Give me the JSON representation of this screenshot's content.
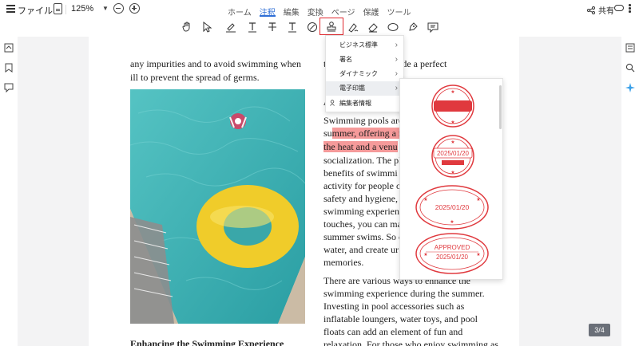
{
  "topbar": {
    "file_label": "ファイル",
    "zoom": "125%",
    "tabs": [
      {
        "label": "ホーム"
      },
      {
        "label": "注釈"
      },
      {
        "label": "編集"
      },
      {
        "label": "変換"
      },
      {
        "label": "ページ"
      },
      {
        "label": "保護"
      },
      {
        "label": "ツール"
      }
    ],
    "share_label": "共有"
  },
  "document": {
    "left_col_lines": [
      "any impurities and to avoid swimming when",
      "ill to prevent the spread of germs."
    ],
    "right_top_line": "t             g the poolside a perfect",
    "right_a_line": "A",
    "right_para1": [
      "Swimming pools are",
      "su",
      "mmer, offering a r",
      "the heat and a venu",
      "socialization. The pl",
      "benefits of swimmi",
      "activity for people o",
      "safety and hygiene,",
      "swimming experien",
      "touches, you can ma",
      "summer swims. So c",
      "water, and create ur",
      "memories."
    ],
    "right_para2": [
      "There are various ways to enhance the",
      "swimming experience during the summer.",
      "Investing in pool accessories such as",
      "inflatable loungers, water toys, and pool",
      "floats can add an element of fun and",
      "relaxation. For those who enjoy swimming as"
    ],
    "section_heading": "Enhancing the Swimming Experience"
  },
  "stamp_menu": {
    "items": [
      {
        "label": "ビジネス標準"
      },
      {
        "label": "署名"
      },
      {
        "label": "ダイナミック"
      },
      {
        "label": "電子印鑑"
      },
      {
        "label": "編集者情報"
      }
    ]
  },
  "stamps": {
    "date1": "2025/01/20",
    "date2": "2025/01/20",
    "approved": "APPROVED",
    "date3": "2025/01/20"
  },
  "page_indicator": "3/4",
  "colors": {
    "accent": "#2f6fd6",
    "stamp_red": "#e0393e",
    "highlight": "#f59a9a"
  }
}
